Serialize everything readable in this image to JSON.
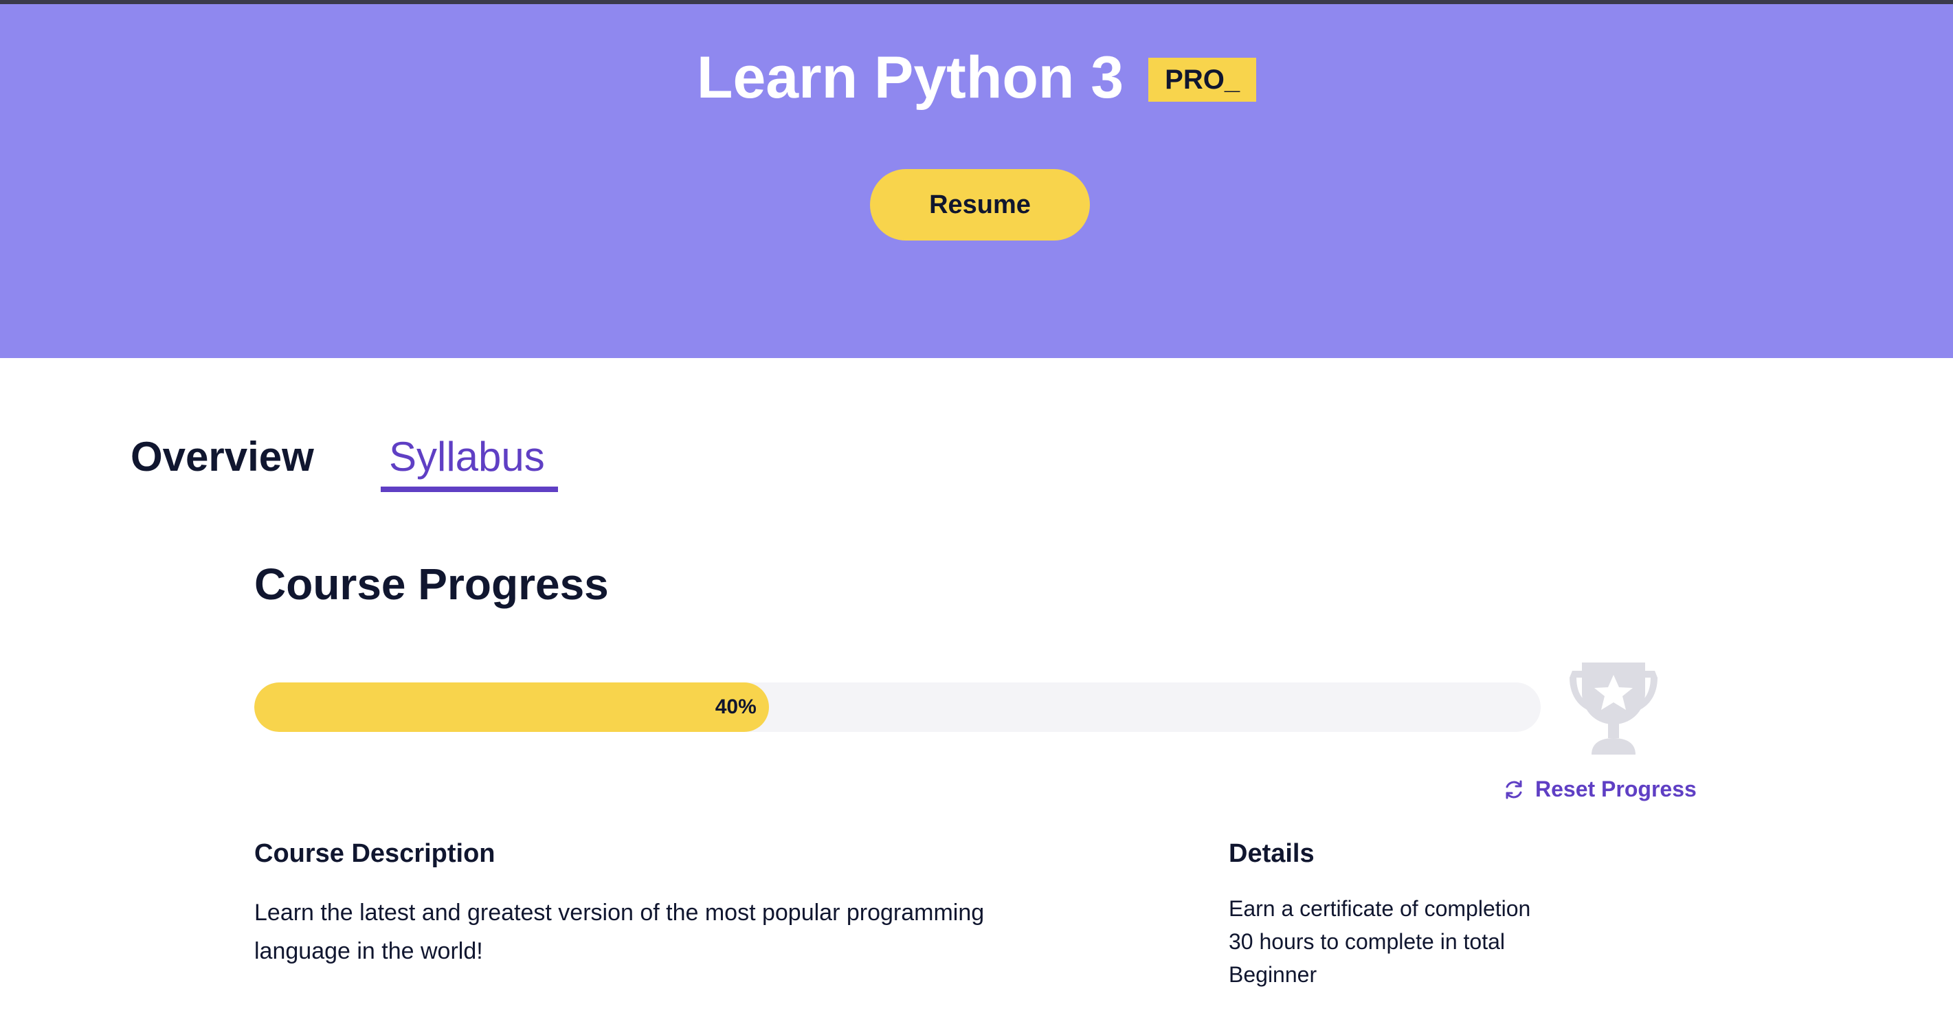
{
  "hero": {
    "title": "Learn Python 3",
    "badge": "PRO_",
    "resume_label": "Resume",
    "background_color": "#8f88ef",
    "accent_color": "#f8d44c"
  },
  "tabs": [
    {
      "label": "Overview",
      "active": false
    },
    {
      "label": "Syllabus",
      "active": true
    }
  ],
  "progress": {
    "section_title": "Course Progress",
    "percent": 40,
    "percent_label": "40%",
    "trophy_icon": "trophy-icon",
    "reset_label": "Reset Progress",
    "reset_icon": "refresh-icon"
  },
  "description": {
    "heading": "Course Description",
    "text": "Learn the latest and greatest version of the most popular programming language in the world!"
  },
  "details": {
    "heading": "Details",
    "items": [
      "Earn a certificate of completion",
      "30 hours to complete in total",
      "Beginner"
    ]
  },
  "colors": {
    "link_purple": "#5f3fc4",
    "text_dark": "#10162f",
    "track_gray": "#f4f4f7"
  }
}
